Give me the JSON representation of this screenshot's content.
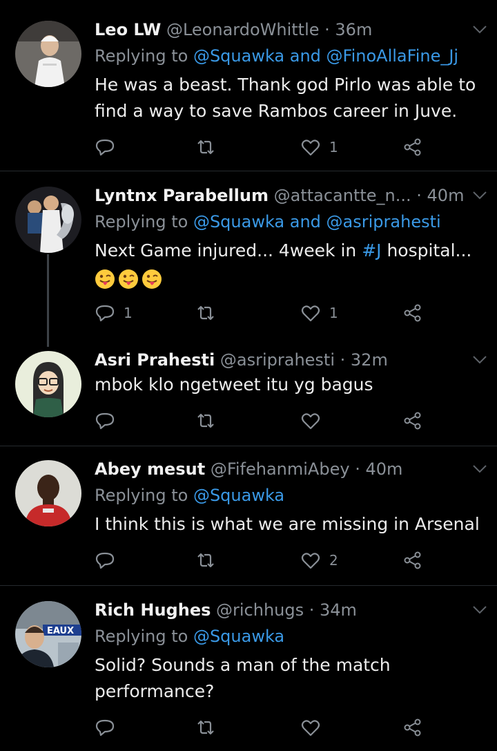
{
  "tweets": [
    {
      "name": "Leo LW",
      "handle": "@LeonardoWhittle",
      "dot": " · ",
      "time": "36m",
      "replying_prefix": "Replying to ",
      "replying_to": "@Squawka and @FinoAllaFine_Jj",
      "text_lines": [
        "He was a beast. Thank god Pirlo was able to",
        "find a way to save Rambos career in Juve."
      ],
      "reply_count": "",
      "like_count": "1"
    },
    {
      "name": "Lyntnx Parabellum",
      "handle": "@attacantte_n...",
      "dot": " · ",
      "time": "40m",
      "replying_prefix": "Replying to ",
      "replying_to": "@Squawka and @asriprahesti",
      "text_before": "Next Game injured... 4week in ",
      "hashtag": "#J",
      "text_after": " hospital...",
      "emoji_icon": "tongue-wink-emoji",
      "reply_count": "1",
      "like_count": "1"
    },
    {
      "name": "Asri Prahesti",
      "handle": "@asriprahesti",
      "dot": " · ",
      "time": "32m",
      "text": "mbok klo ngetweet itu yg bagus",
      "reply_count": "",
      "like_count": ""
    },
    {
      "name": "Abey mesut",
      "handle": "@FifehanmiAbey",
      "dot": " · ",
      "time": "40m",
      "replying_prefix": "Replying to ",
      "replying_to": "@Squawka",
      "text": "I think this is what we are missing in Arsenal",
      "reply_count": "",
      "like_count": "2"
    },
    {
      "name": "Rich Hughes",
      "handle": "@richhugs",
      "dot": " · ",
      "time": "34m",
      "replying_prefix": "Replying to ",
      "replying_to": "@Squawka",
      "text_lines": [
        "Solid? Sounds a man of the match",
        "performance?"
      ],
      "avatar_banner_text": "EAUX",
      "reply_count": "",
      "like_count": ""
    }
  ],
  "colors": {
    "background": "#000000",
    "link": "#3a99e6",
    "muted": "#8a9097",
    "divider": "#262a2e"
  },
  "icons": [
    "reply-icon",
    "retweet-icon",
    "like-icon",
    "share-icon",
    "chevron-down-icon"
  ]
}
